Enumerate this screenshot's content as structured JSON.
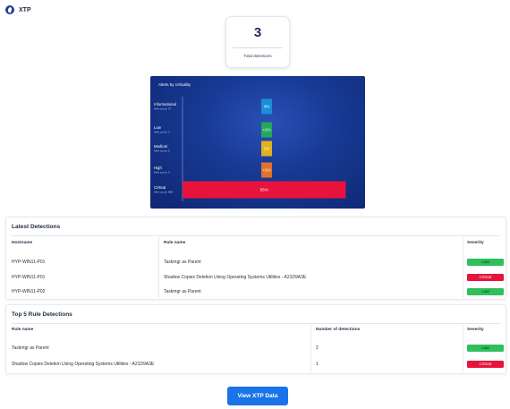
{
  "app": {
    "title": "XTP",
    "logo_icon": "xtp-logo-icon"
  },
  "kpi": {
    "value": "3",
    "label": "Total detections"
  },
  "chart_data": {
    "type": "bar",
    "orientation": "horizontal",
    "title": "Alerts by criticality",
    "categories": [
      {
        "label": "Informational",
        "sublabel": "Alert count: 37",
        "value_label": "4%",
        "percent": 4,
        "color": "#1a8fd8"
      },
      {
        "label": "Low",
        "sublabel": "Alert count: 3",
        "value_label": "<1%",
        "percent": 1,
        "color": "#24a85a"
      },
      {
        "label": "Medium",
        "sublabel": "Alert count: 9",
        "value_label": "1%",
        "percent": 1,
        "color": "#e0b21c"
      },
      {
        "label": "High",
        "sublabel": "Alert count: 3",
        "value_label": "<1%",
        "percent": 1,
        "color": "#e0722c"
      },
      {
        "label": "Critical",
        "sublabel": "Alert count: 868",
        "value_label": "95%",
        "percent": 95,
        "color": "#e8133c"
      }
    ],
    "background": "#173a94",
    "grid": false,
    "legend": "none"
  },
  "latest": {
    "title": "Latest Detections",
    "columns": [
      "Hostname",
      "Rule name",
      "Severity"
    ],
    "rows": [
      {
        "hostname": "HYP-WIN11-P01",
        "rule": "Taskmgr as Parent",
        "severity": "Low",
        "level": "low"
      },
      {
        "hostname": "HYP-WIN11-P01",
        "rule": "Shadow Copies Deletion Using Operating Systems Utilities - A21D9A3E",
        "severity": "Critical",
        "level": "critical"
      },
      {
        "hostname": "HYP-WIN11-P02",
        "rule": "Taskmgr as Parent",
        "severity": "Low",
        "level": "low"
      }
    ]
  },
  "top5": {
    "title": "Top 5 Rule Detections",
    "columns": [
      "Rule name",
      "Number of detections",
      "Severity"
    ],
    "rows": [
      {
        "rule": "Taskmgr as Parent",
        "count": "2",
        "severity": "Low",
        "level": "low"
      },
      {
        "rule": "Shadow Copies Deletion Using Operating Systems Utilities - A21D9A3E",
        "count": "1",
        "severity": "Critical",
        "level": "critical"
      }
    ]
  },
  "button": {
    "label": "View XTP Data"
  },
  "colors": {
    "accent": "#1a73e8",
    "low": "#2fc05c",
    "critical": "#e8133c"
  }
}
